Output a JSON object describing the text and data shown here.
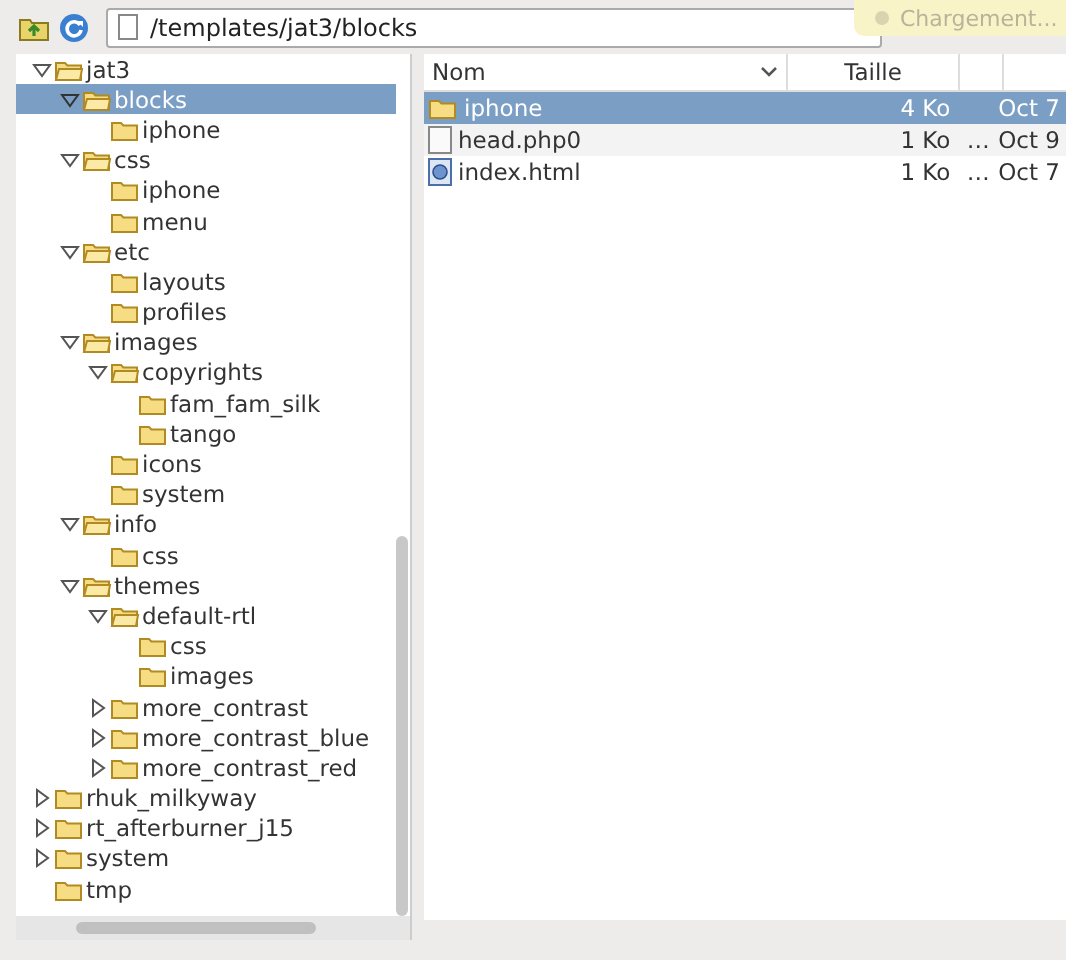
{
  "toolbar": {
    "path": "/templates/jat3/blocks"
  },
  "notification": {
    "text": "Chargement..."
  },
  "tree": [
    {
      "name": "jat3",
      "expanded": true,
      "selected": false,
      "children": [
        {
          "name": "blocks",
          "expanded": true,
          "selected": true,
          "children": [
            {
              "name": "iphone",
              "selected": false
            }
          ]
        },
        {
          "name": "css",
          "expanded": true,
          "selected": false,
          "children": [
            {
              "name": "iphone",
              "selected": false
            },
            {
              "name": "menu",
              "selected": false
            }
          ]
        },
        {
          "name": "etc",
          "expanded": true,
          "selected": false,
          "children": [
            {
              "name": "layouts",
              "selected": false
            },
            {
              "name": "profiles",
              "selected": false
            }
          ]
        },
        {
          "name": "images",
          "expanded": true,
          "selected": false,
          "children": [
            {
              "name": "copyrights",
              "expanded": true,
              "selected": false,
              "children": [
                {
                  "name": "fam_fam_silk",
                  "selected": false
                },
                {
                  "name": "tango",
                  "selected": false
                }
              ]
            },
            {
              "name": "icons",
              "selected": false
            },
            {
              "name": "system",
              "selected": false
            }
          ]
        },
        {
          "name": "info",
          "expanded": true,
          "selected": false,
          "children": [
            {
              "name": "css",
              "selected": false
            }
          ]
        },
        {
          "name": "themes",
          "expanded": true,
          "selected": false,
          "children": [
            {
              "name": "default-rtl",
              "expanded": true,
              "selected": false,
              "children": [
                {
                  "name": "css",
                  "selected": false
                },
                {
                  "name": "images",
                  "selected": false
                }
              ]
            },
            {
              "name": "more_contrast",
              "expanded": false,
              "selected": false
            },
            {
              "name": "more_contrast_blue",
              "expanded": false,
              "selected": false
            },
            {
              "name": "more_contrast_red",
              "expanded": false,
              "selected": false
            }
          ]
        }
      ]
    },
    {
      "name": "rhuk_milkyway",
      "expanded": false,
      "selected": false
    },
    {
      "name": "rt_afterburner_j15",
      "expanded": false,
      "selected": false
    },
    {
      "name": "system",
      "expanded": false,
      "selected": false
    },
    {
      "name": "tmp",
      "selected": false
    }
  ],
  "files": {
    "columns": [
      {
        "label": "Nom",
        "sort": true
      },
      {
        "label": "Taille",
        "sort": false
      }
    ],
    "rows": [
      {
        "kind": "folder",
        "name": "iphone",
        "size": "4 Ko",
        "date": "Oct 7",
        "selected": true
      },
      {
        "kind": "file",
        "name": "head.php0",
        "size": "1 Ko",
        "type": "…",
        "date": "Oct 9",
        "selected": false
      },
      {
        "kind": "html",
        "name": "index.html",
        "size": "1 Ko",
        "type": "…",
        "date": "Oct 7",
        "selected": false
      }
    ]
  }
}
